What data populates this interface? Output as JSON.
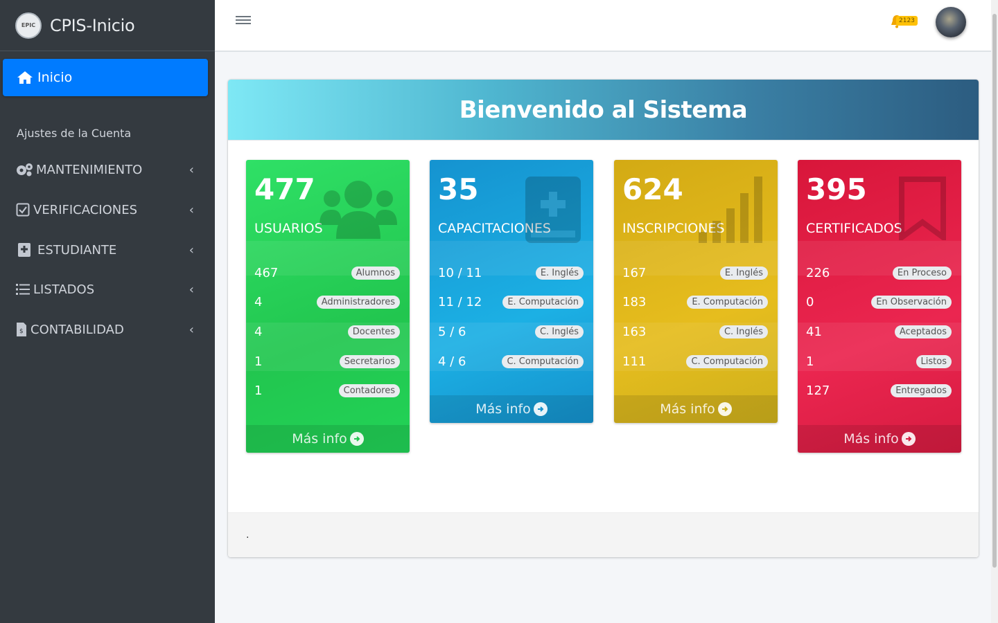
{
  "brand": {
    "name": "CPIS-Inicio",
    "logo_text": "EPIC"
  },
  "sidebar": {
    "active": "Inicio",
    "header": "Ajustes de la Cuenta",
    "items": [
      {
        "label": "MANTENIMIENTO",
        "icon": "gears-icon"
      },
      {
        "label": "VERIFICACIONES",
        "icon": "check-square-icon"
      },
      {
        "label": "ESTUDIANTE",
        "icon": "plus-square-icon"
      },
      {
        "label": "LISTADOS",
        "icon": "list-icon"
      },
      {
        "label": "CONTABILIDAD",
        "icon": "file-invoice-icon"
      }
    ]
  },
  "topbar": {
    "notification_count": "2123"
  },
  "panel": {
    "title": "Bienvenido al Sistema",
    "footer_text": "."
  },
  "boxes": [
    {
      "count": "477",
      "label": "USUARIOS",
      "color": "#22c64f",
      "icon": "users-icon",
      "rows": [
        {
          "value": "467",
          "tag": "Alumnos"
        },
        {
          "value": "4",
          "tag": "Administradores"
        },
        {
          "value": "4",
          "tag": "Docentes"
        },
        {
          "value": "1",
          "tag": "Secretarios"
        },
        {
          "value": "1",
          "tag": "Contadores"
        }
      ],
      "more": "Más info"
    },
    {
      "count": "35",
      "label": "CAPACITACIONES",
      "color": "#17a2d8",
      "icon": "book-medical-icon",
      "rows": [
        {
          "value": "10 / 11",
          "tag": "E. Inglés"
        },
        {
          "value": "11 / 12",
          "tag": "E. Computación"
        },
        {
          "value": "5 / 6",
          "tag": "C. Inglés"
        },
        {
          "value": "4 / 6",
          "tag": "C. Computación"
        }
      ],
      "more": "Más info"
    },
    {
      "count": "624",
      "label": "INSCRIPCIONES",
      "color": "#e0b51a",
      "icon": "signal-icon",
      "rows": [
        {
          "value": "167",
          "tag": "E. Inglés"
        },
        {
          "value": "183",
          "tag": "E. Computación"
        },
        {
          "value": "163",
          "tag": "C. Inglés"
        },
        {
          "value": "111",
          "tag": "C. Computación"
        }
      ],
      "more": "Más info"
    },
    {
      "count": "395",
      "label": "CERTIFICADOS",
      "color": "#e3204a",
      "icon": "bookmark-icon",
      "rows": [
        {
          "value": "226",
          "tag": "En Proceso"
        },
        {
          "value": "0",
          "tag": "En Observación"
        },
        {
          "value": "41",
          "tag": "Aceptados"
        },
        {
          "value": "1",
          "tag": "Listos"
        },
        {
          "value": "127",
          "tag": "Entregados"
        }
      ],
      "more": "Más info"
    }
  ]
}
